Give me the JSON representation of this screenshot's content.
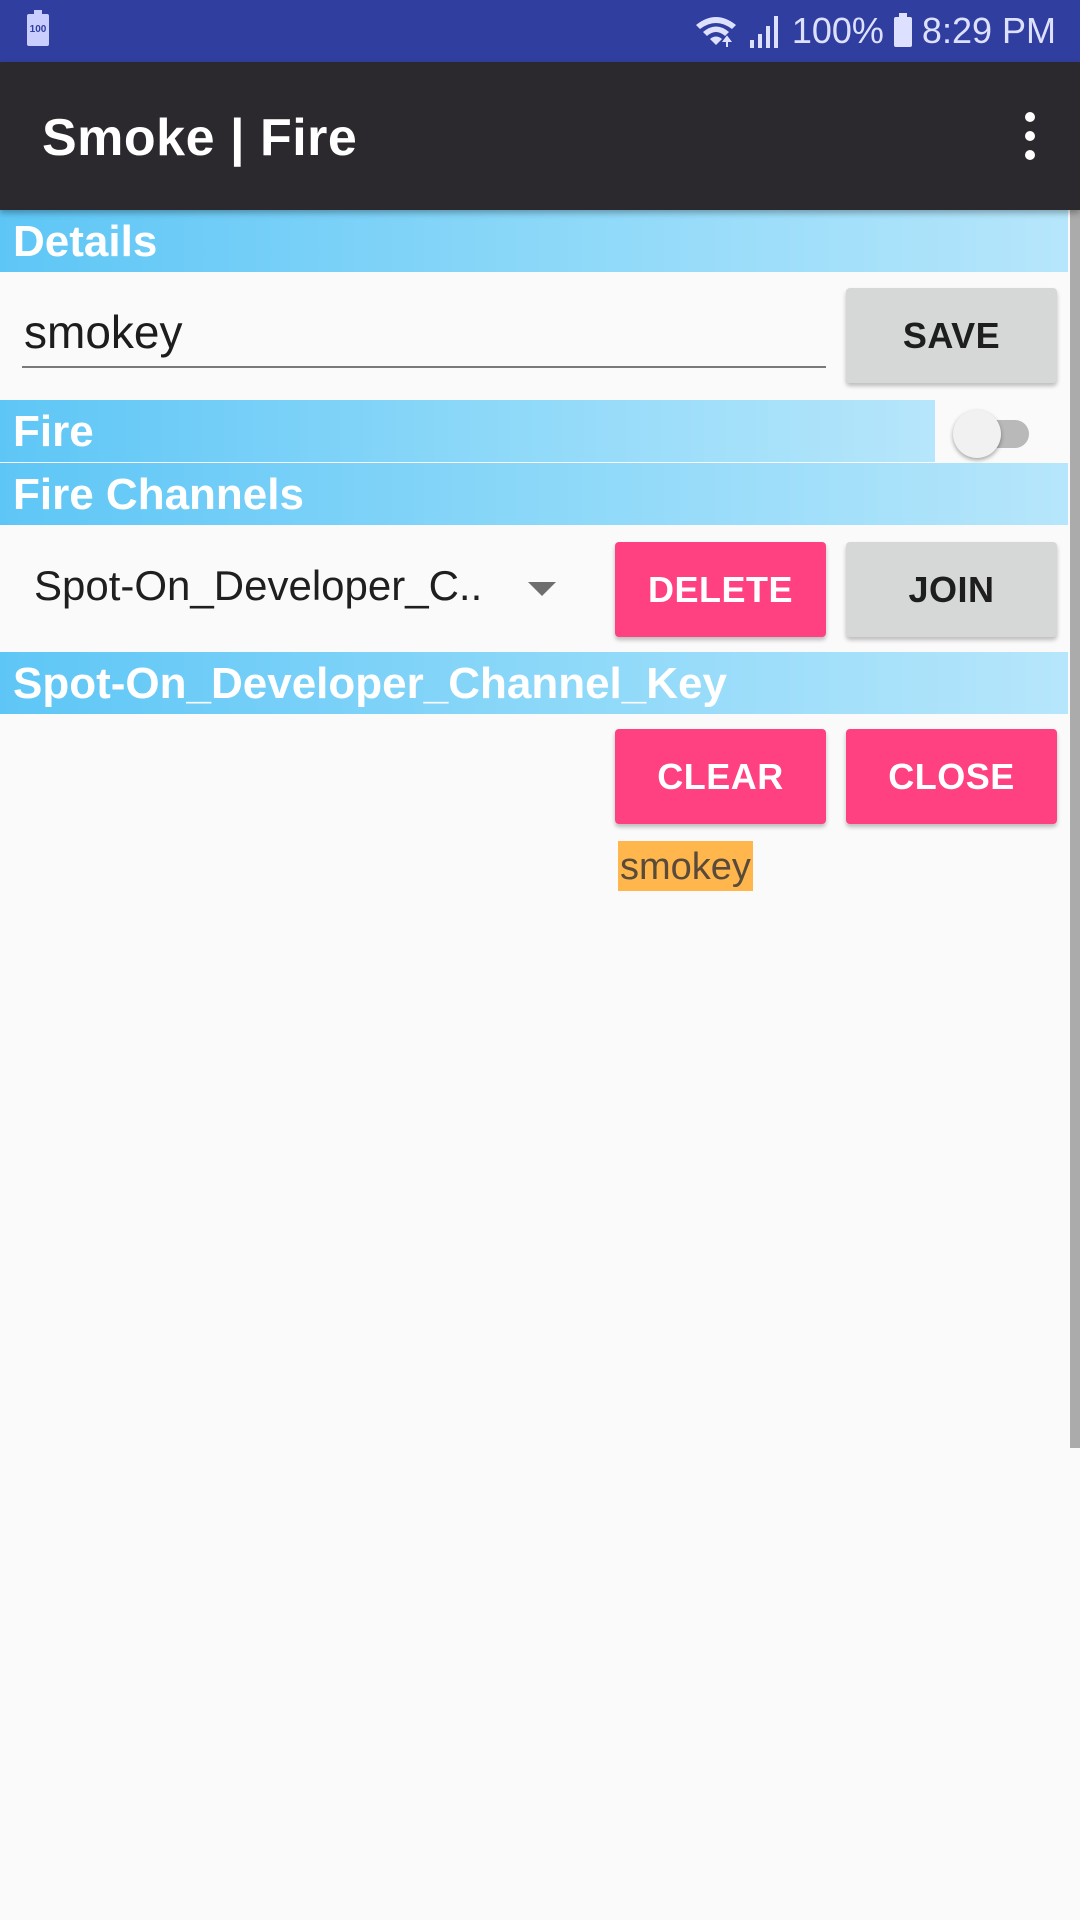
{
  "status_bar": {
    "left_icon_text": "100",
    "battery_percent": "100%",
    "time": "8:29 PM",
    "icons": [
      "battery-saver-icon",
      "wifi-icon",
      "signal-icon",
      "battery-icon"
    ]
  },
  "app_bar": {
    "title": "Smoke | Fire",
    "menu_icon": "overflow-menu-icon"
  },
  "details": {
    "header": "Details",
    "name_value": "smokey",
    "save_label": "SAVE"
  },
  "fire": {
    "header": "Fire",
    "switch_on": false
  },
  "fire_channels": {
    "header": "Fire Channels",
    "selected_channel": "Spot-On_Developer_C..",
    "delete_label": "DELETE",
    "join_label": "JOIN"
  },
  "channel": {
    "header": "Spot-On_Developer_Channel_Key",
    "clear_label": "CLEAR",
    "close_label": "CLOSE",
    "messages": [
      "smokey"
    ]
  },
  "colors": {
    "status_bar": "#303f9f",
    "app_bar": "#2b292e",
    "accent_pink": "#ff4081",
    "header_blue": "#5ec6f6",
    "message_highlight": "#ffb74d"
  }
}
